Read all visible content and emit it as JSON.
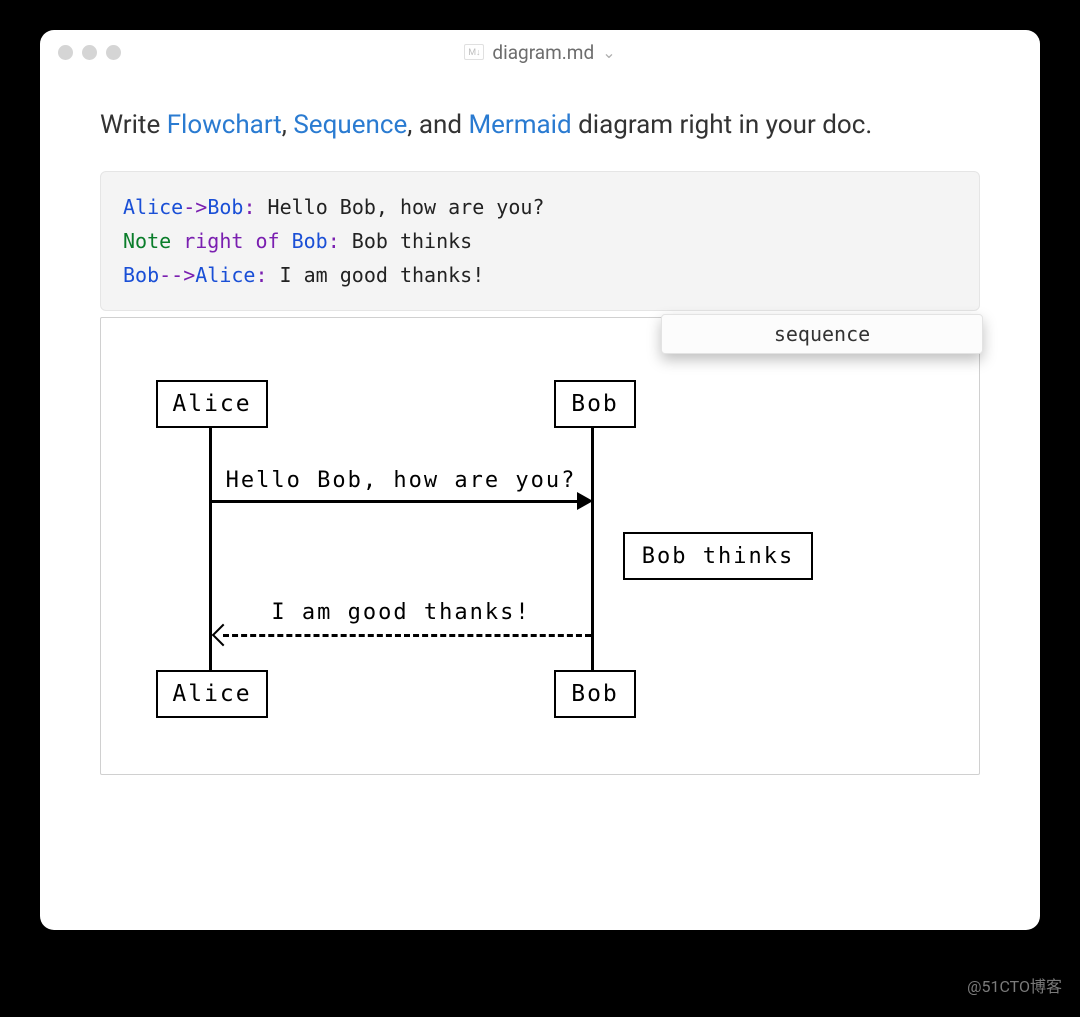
{
  "window": {
    "filename": "diagram.md",
    "ext_badge": "M↓"
  },
  "intro": {
    "pre": "Write ",
    "link1": "Flowchart",
    "sep1": ", ",
    "link2": "Sequence",
    "sep2": ", and ",
    "link3": "Mermaid",
    "post": " diagram right in your doc."
  },
  "code": {
    "l1_from": "Alice",
    "l1_arrow": "->",
    "l1_to": "Bob",
    "l1_colon": ":",
    "l1_msg": " Hello Bob, how are you?",
    "l2_kw": "Note",
    "l2_pos": " right of ",
    "l2_target": "Bob",
    "l2_colon": ":",
    "l2_msg": " Bob thinks",
    "l3_from": "Bob",
    "l3_arrow": "-->",
    "l3_to": "Alice",
    "l3_colon": ":",
    "l3_msg": " I am good thanks!"
  },
  "diagram": {
    "type_label": "sequence",
    "actor_a": "Alice",
    "actor_b": "Bob",
    "msg1": "Hello Bob, how are you?",
    "msg2": "I am good thanks!",
    "note": "Bob thinks"
  },
  "watermark": "@51CTO博客"
}
